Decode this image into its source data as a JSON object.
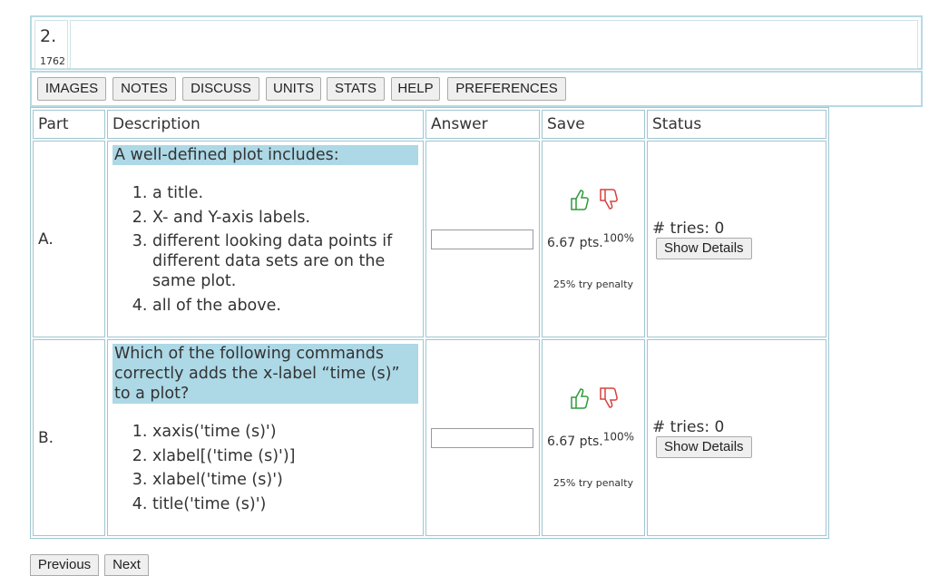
{
  "question": {
    "number": "2.",
    "id": "1762"
  },
  "toolbar": {
    "images": "IMAGES",
    "notes": "NOTES",
    "discuss": "DISCUSS",
    "units": "UNITS",
    "stats": "STATS",
    "help": "HELP",
    "preferences": "PREFERENCES"
  },
  "table": {
    "headers": {
      "part": "Part",
      "description": "Description",
      "answer": "Answer",
      "save": "Save",
      "status": "Status"
    },
    "parts": [
      {
        "label": "A.",
        "prompt": "A well-defined plot includes:",
        "options": [
          "a title.",
          "X- and Y-axis labels.",
          "different looking data points if different data sets are on the same plot.",
          "all of the above."
        ],
        "answer_value": "",
        "points": "6.67 pts.",
        "percent": "100%",
        "penalty": "25% try penalty",
        "tries": "# tries: 0",
        "details_label": "Show Details"
      },
      {
        "label": "B.",
        "prompt": "Which of the following commands correctly adds the x-label “time (s)” to a plot?",
        "options": [
          "xaxis('time (s)')",
          "xlabel[('time (s)')]",
          "xlabel('time (s)')",
          "title('time (s)')"
        ],
        "answer_value": "",
        "points": "6.67 pts.",
        "percent": "100%",
        "penalty": "25% try penalty",
        "tries": "# tries: 0",
        "details_label": "Show Details"
      }
    ]
  },
  "icons": {
    "thumbs_up": "thumbs-up-icon",
    "thumbs_down": "thumbs-down-icon"
  },
  "colors": {
    "highlight": "#add8e6",
    "border": "#9fc6d3",
    "thumb_up": "#2e9b3a",
    "thumb_down": "#d94040"
  },
  "nav": {
    "previous": "Previous",
    "next": "Next"
  }
}
